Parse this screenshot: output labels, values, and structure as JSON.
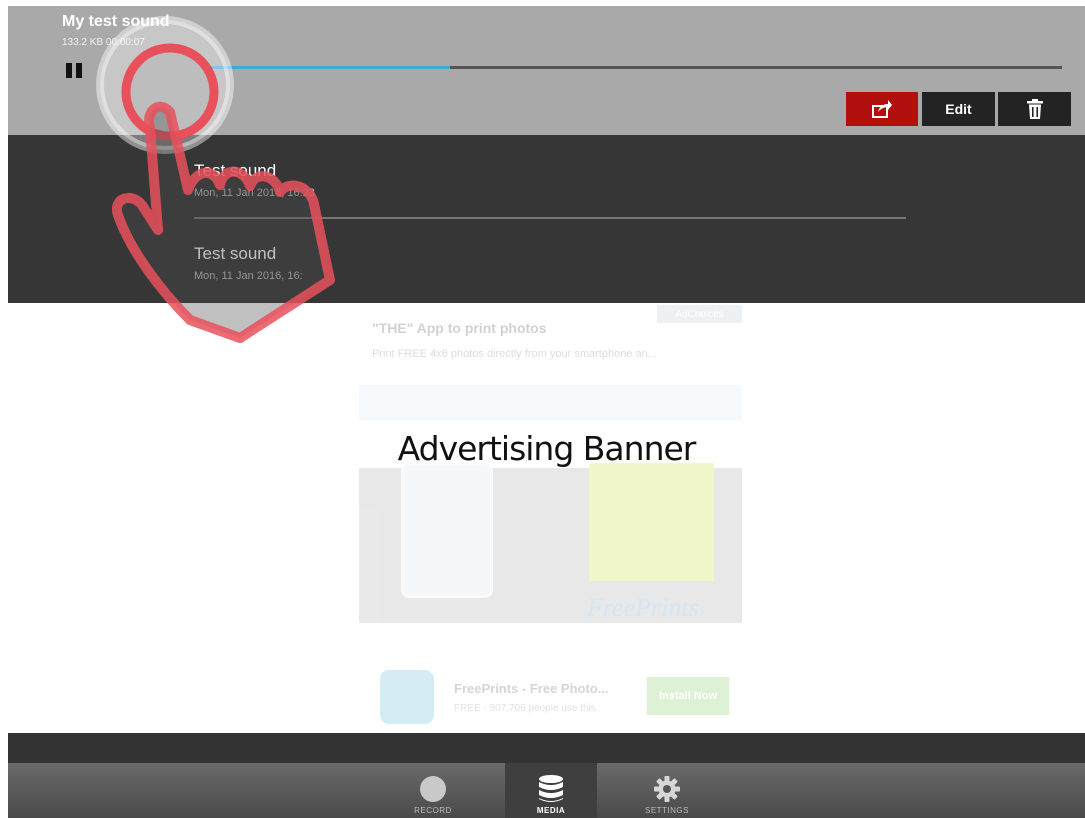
{
  "player": {
    "title": "My test sound",
    "meta": "133.2 KB 00:00:07",
    "progress": 0.33,
    "actions": {
      "share_icon": "share-icon",
      "edit_label": "Edit",
      "delete_icon": "trash-icon"
    }
  },
  "recordings": [
    {
      "name": "Test sound",
      "date": "Mon, 11 Jan 2016, 16:23"
    },
    {
      "name": "Test sound",
      "date": "Mon, 11 Jan 2016, 16:"
    }
  ],
  "ad": {
    "label": "Advertising Banner",
    "headline": "\"THE\" App to print photos",
    "sub": "Print FREE 4x6 photos directly from your smartphone an...",
    "choices": "AdChoices",
    "brand": "FreePrints",
    "app_title": "FreePrints - Free Photo...",
    "app_sub": "FREE - 907,706 people use this",
    "install_label": "Install Now"
  },
  "tabs": [
    {
      "label": "RECORD",
      "icon": "record-icon",
      "active": false
    },
    {
      "label": "MEDIA",
      "icon": "database-icon",
      "active": true
    },
    {
      "label": "SETTINGS",
      "icon": "gear-icon",
      "active": false
    }
  ],
  "colors": {
    "header_bg": "#a9a9a9",
    "list_bg": "#363636",
    "progress": "#3fa9d9",
    "share_button": "#b2100f",
    "gesture_hand": "#e8505b"
  }
}
